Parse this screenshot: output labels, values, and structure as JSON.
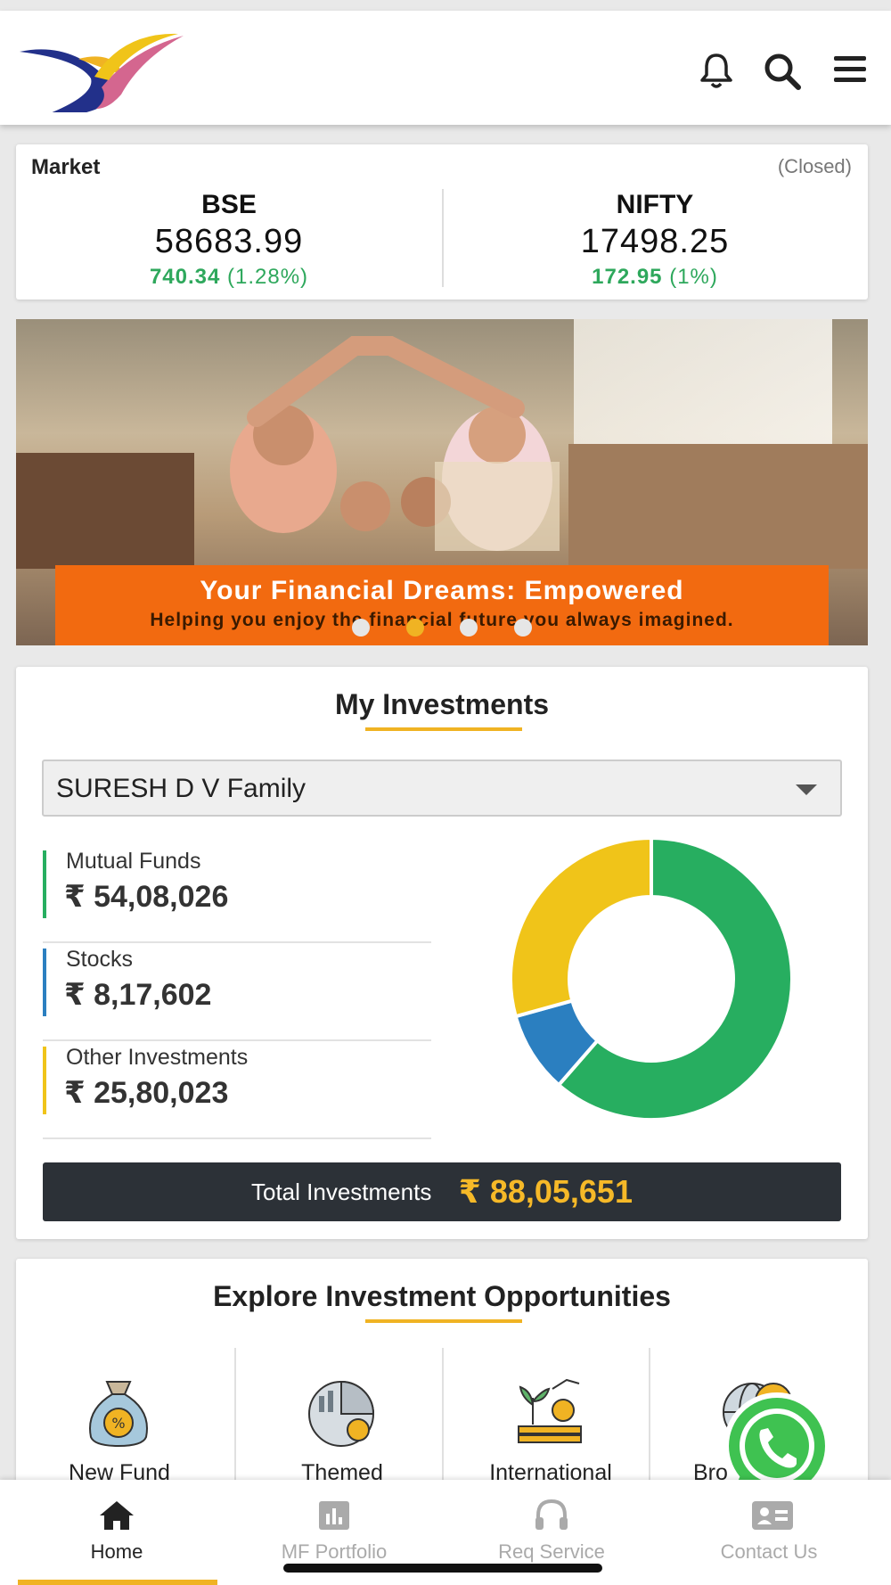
{
  "header": {
    "icons": [
      "bell-icon",
      "search-icon",
      "menu-icon"
    ]
  },
  "market": {
    "label": "Market",
    "status": "(Closed)",
    "indices": [
      {
        "name": "BSE",
        "value": "58683.99",
        "change_points": "740.34",
        "change_percent": "(1.28%)"
      },
      {
        "name": "NIFTY",
        "value": "17498.25",
        "change_points": "172.95",
        "change_percent": "(1%)"
      }
    ]
  },
  "banner": {
    "title": "Your Financial Dreams: Empowered",
    "subtitle": "Helping you enjoy the financial future you always imagined.",
    "slide_count": 4,
    "active_slide": 2
  },
  "investments": {
    "title": "My Investments",
    "selected_family": "SURESH D V Family",
    "items": [
      {
        "name": "Mutual Funds",
        "amount": "₹ 54,08,026",
        "color": "#27ae60",
        "value": 5408026
      },
      {
        "name": "Stocks",
        "amount": "₹ 8,17,602",
        "color": "#2b7fc0",
        "value": 817602
      },
      {
        "name": "Other Investments",
        "amount": "₹ 25,80,023",
        "color": "#f0c419",
        "value": 2580023
      }
    ],
    "total_label": "Total Investments",
    "total_amount": "₹ 88,05,651"
  },
  "explore": {
    "title": "Explore Investment Opportunities",
    "tiles": [
      {
        "label": "New Fund",
        "icon": "money-bag-icon"
      },
      {
        "label": "Themed",
        "icon": "themed-chart-icon"
      },
      {
        "label": "International",
        "icon": "plant-growth-icon"
      },
      {
        "label": "Bro",
        "icon": "globe-coin-icon"
      }
    ]
  },
  "bottom_nav": {
    "items": [
      {
        "label": "Home",
        "icon": "home-icon"
      },
      {
        "label": "MF Portfolio",
        "icon": "bar-chart-icon"
      },
      {
        "label": "Req Service",
        "icon": "headset-icon"
      },
      {
        "label": "Contact Us",
        "icon": "contact-card-icon"
      }
    ]
  },
  "colors": {
    "accent": "#f0b323",
    "positive": "#2ea85c",
    "dark_bar": "#2c3137",
    "banner_orange": "#f26a10",
    "whatsapp": "#3fc251"
  }
}
